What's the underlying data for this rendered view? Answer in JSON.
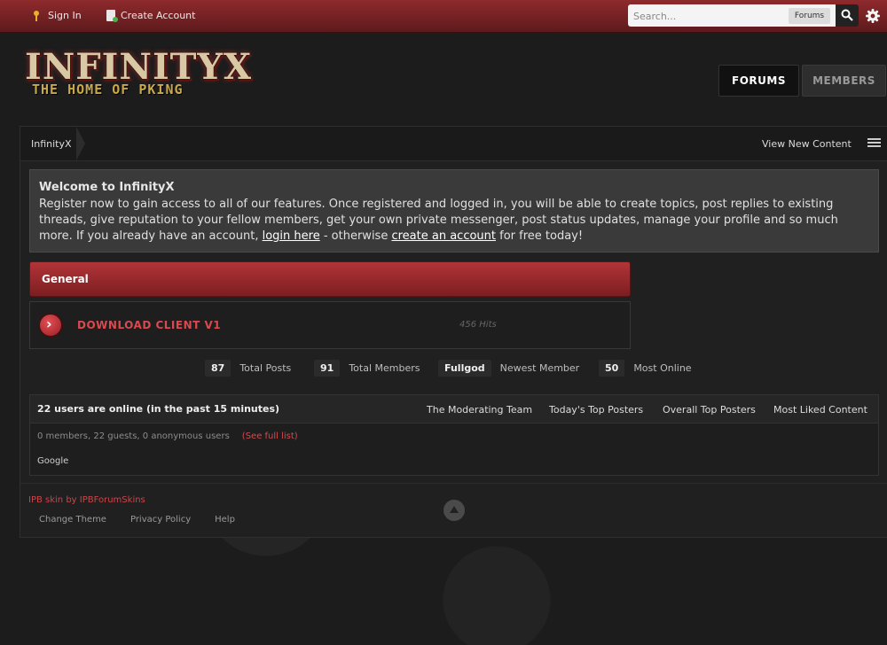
{
  "topbar": {
    "sign_in": "Sign In",
    "create_account": "Create Account",
    "search_placeholder": "Search...",
    "search_scope": "Forums",
    "icons": [
      "key-icon",
      "clipboard-icon",
      "search-icon",
      "gear-icon"
    ]
  },
  "header": {
    "logo_title": "INFINITYX",
    "logo_subtitle": "THE HOME OF PKING",
    "tabs": [
      {
        "label": "FORUMS",
        "active": true
      },
      {
        "label": "MEMBERS",
        "active": false
      }
    ]
  },
  "breadcrumb": {
    "home": "InfinityX",
    "view_new_content": "View New Content"
  },
  "welcome": {
    "title": "Welcome to InfinityX",
    "text_before": "Register now to gain access to all of our features. Once registered and logged in, you will be able to create topics, post replies to existing threads, give reputation to your fellow members, get your own private messenger, post status updates, manage your profile and so much more. If you already have an account, ",
    "login_link": "login here",
    "text_middle": " - otherwise ",
    "create_link": "create an account",
    "text_after": " for free today!"
  },
  "category": {
    "title": "General",
    "forums": [
      {
        "name": "DOWNLOAD CLIENT V1",
        "hits": "456 Hits"
      }
    ]
  },
  "stats": [
    {
      "value": "87",
      "label": "Total Posts"
    },
    {
      "value": "91",
      "label": "Total Members"
    },
    {
      "value": "Fullgod",
      "label": "Newest Member"
    },
    {
      "value": "50",
      "label": "Most Online"
    }
  ],
  "online": {
    "title": "22 users are online (in the past 15 minutes)",
    "links": [
      "The Moderating Team",
      "Today's Top Posters",
      "Overall Top Posters",
      "Most Liked Content"
    ],
    "summary": "0 members, 22 guests, 0 anonymous users",
    "see_full_list": "(See full list)",
    "users": "Google"
  },
  "footer": {
    "credit": "IPB skin  by IPBForumSkins",
    "links": [
      "Change Theme",
      "Privacy Policy",
      "Help"
    ]
  },
  "colors": {
    "accent_red": "#b23438",
    "link_red": "#d84a4f",
    "background": "#1b1b1b"
  }
}
